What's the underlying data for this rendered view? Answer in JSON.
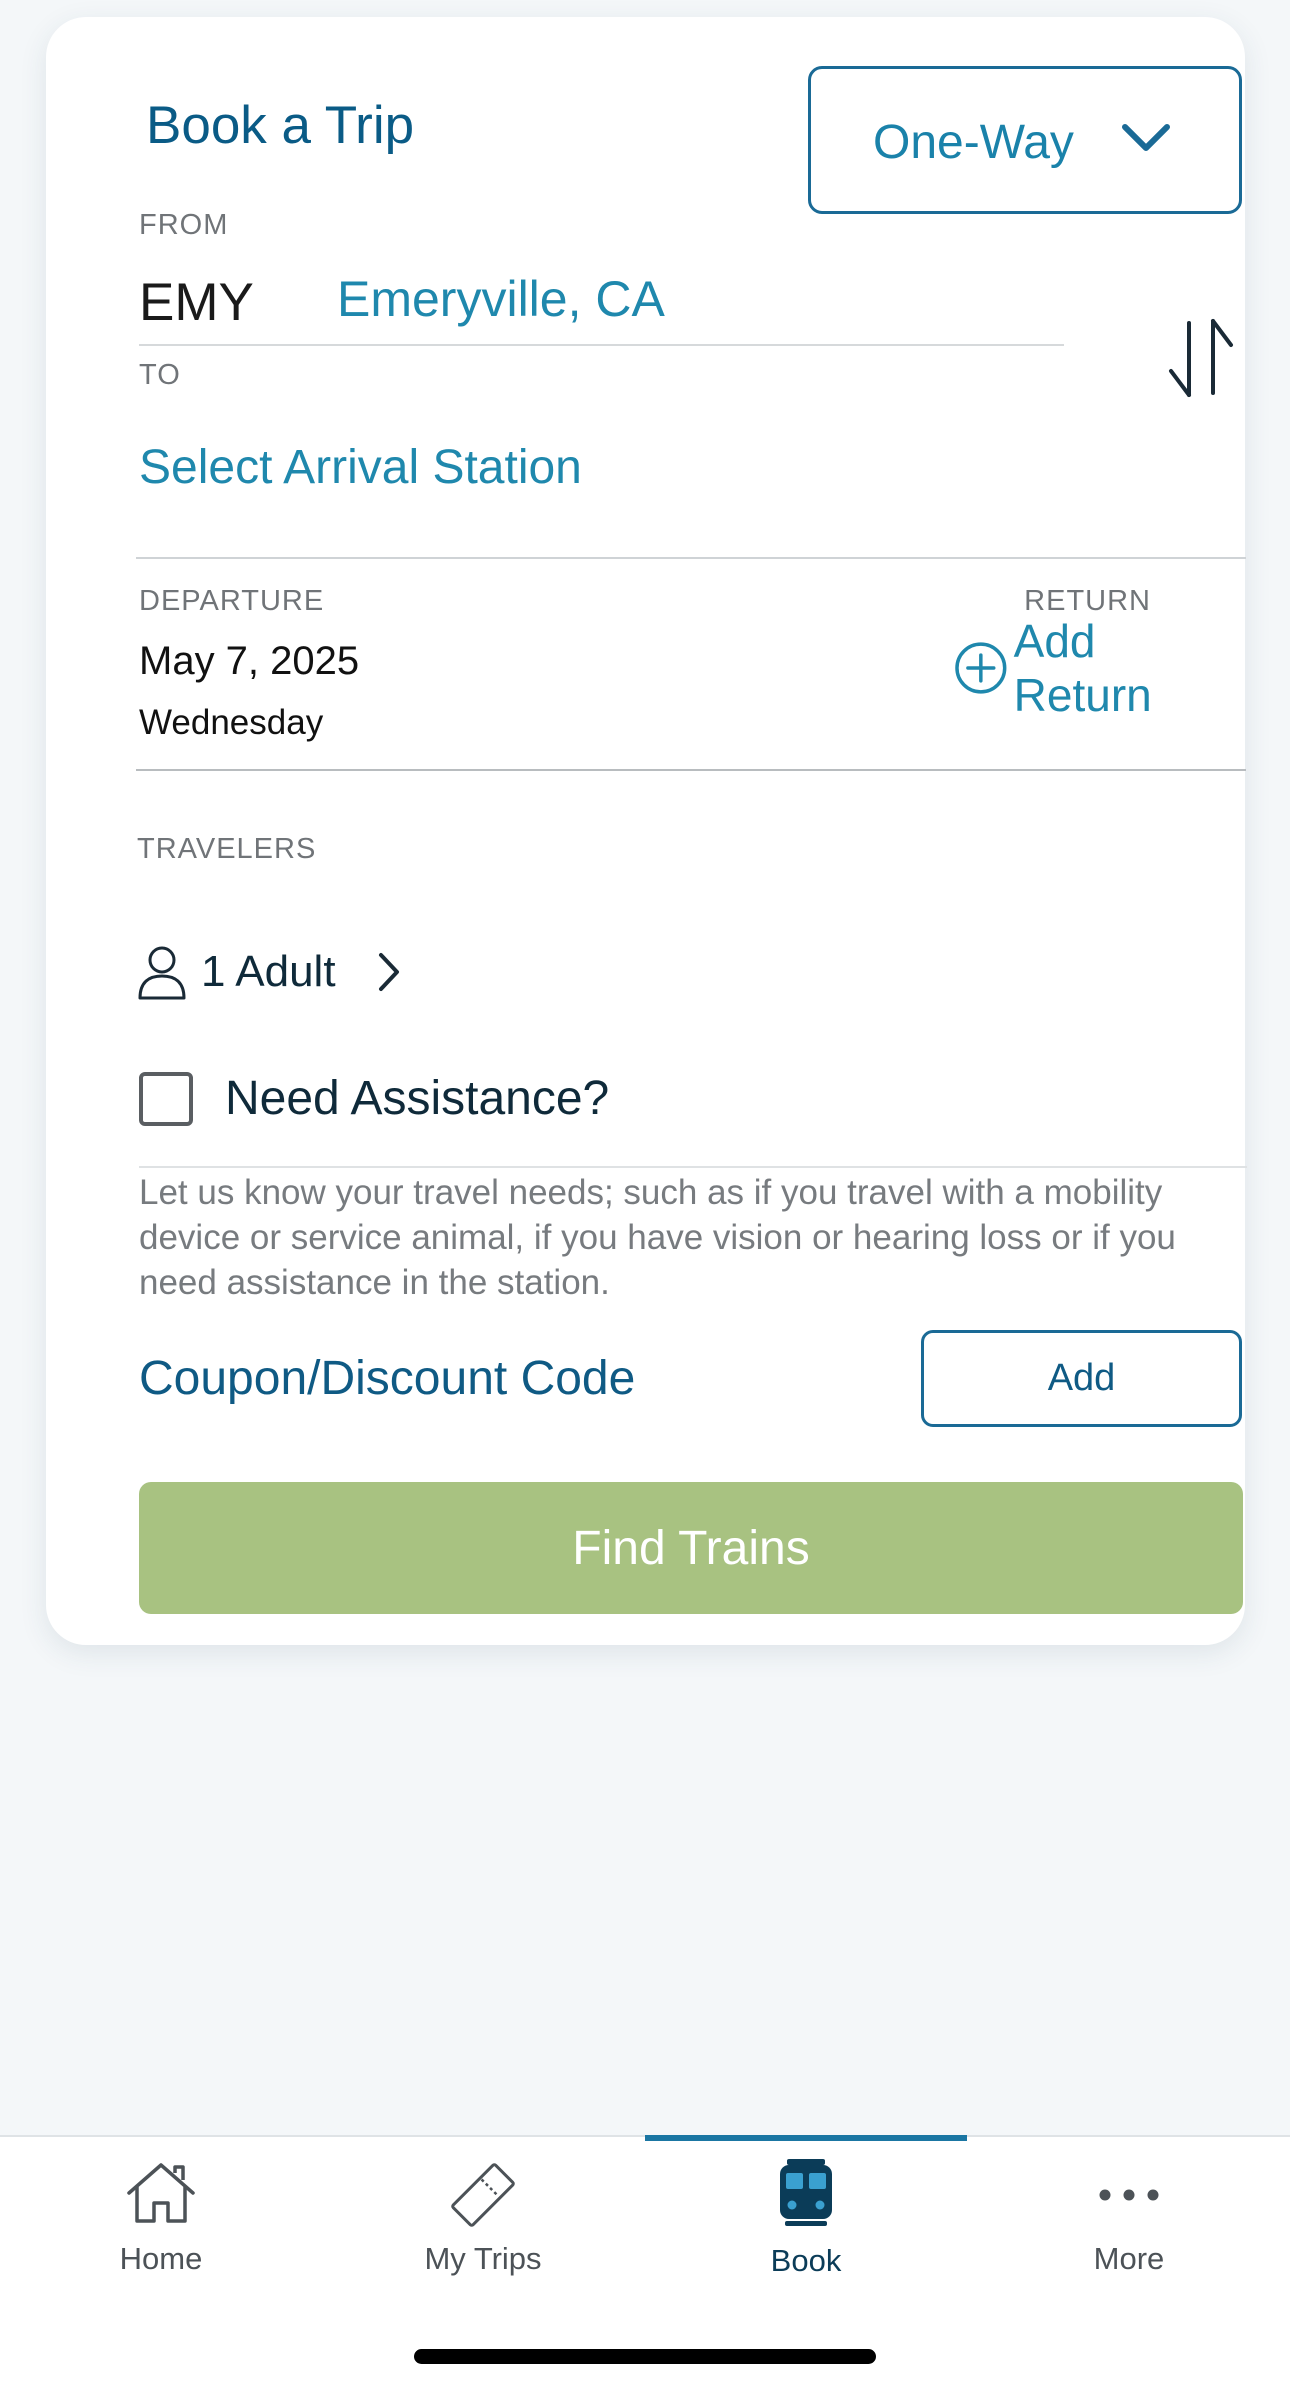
{
  "header": {
    "title": "Book a Trip",
    "trip_type": "One-Way"
  },
  "from": {
    "label": "FROM",
    "code": "EMY",
    "city": "Emeryville, CA"
  },
  "to": {
    "label": "TO",
    "placeholder": "Select Arrival Station"
  },
  "departure": {
    "label": "DEPARTURE",
    "date": "May 7, 2025",
    "day": "Wednesday"
  },
  "return": {
    "label": "RETURN",
    "add_label": "Add Return"
  },
  "travelers": {
    "label": "TRAVELERS",
    "value": "1 Adult"
  },
  "assistance": {
    "label": "Need Assistance?",
    "checked": false,
    "description": "Let us know your travel needs; such as if you travel with a mobility device or service animal, if you have vision or hearing loss or if you need assistance in the station."
  },
  "coupon": {
    "label": "Coupon/Discount Code",
    "button_label": "Add"
  },
  "find_button": {
    "label": "Find Trains",
    "color": "#a8c281"
  },
  "tabs": [
    {
      "label": "Home",
      "icon": "home-icon",
      "active": false
    },
    {
      "label": "My Trips",
      "icon": "ticket-icon",
      "active": false
    },
    {
      "label": "Book",
      "icon": "train-icon",
      "active": true
    },
    {
      "label": "More",
      "icon": "more-icon",
      "active": false
    }
  ],
  "colors": {
    "accent": "#1f88ad",
    "brand_dark": "#0a5b86",
    "tab_indicator": "#1a76a3"
  }
}
